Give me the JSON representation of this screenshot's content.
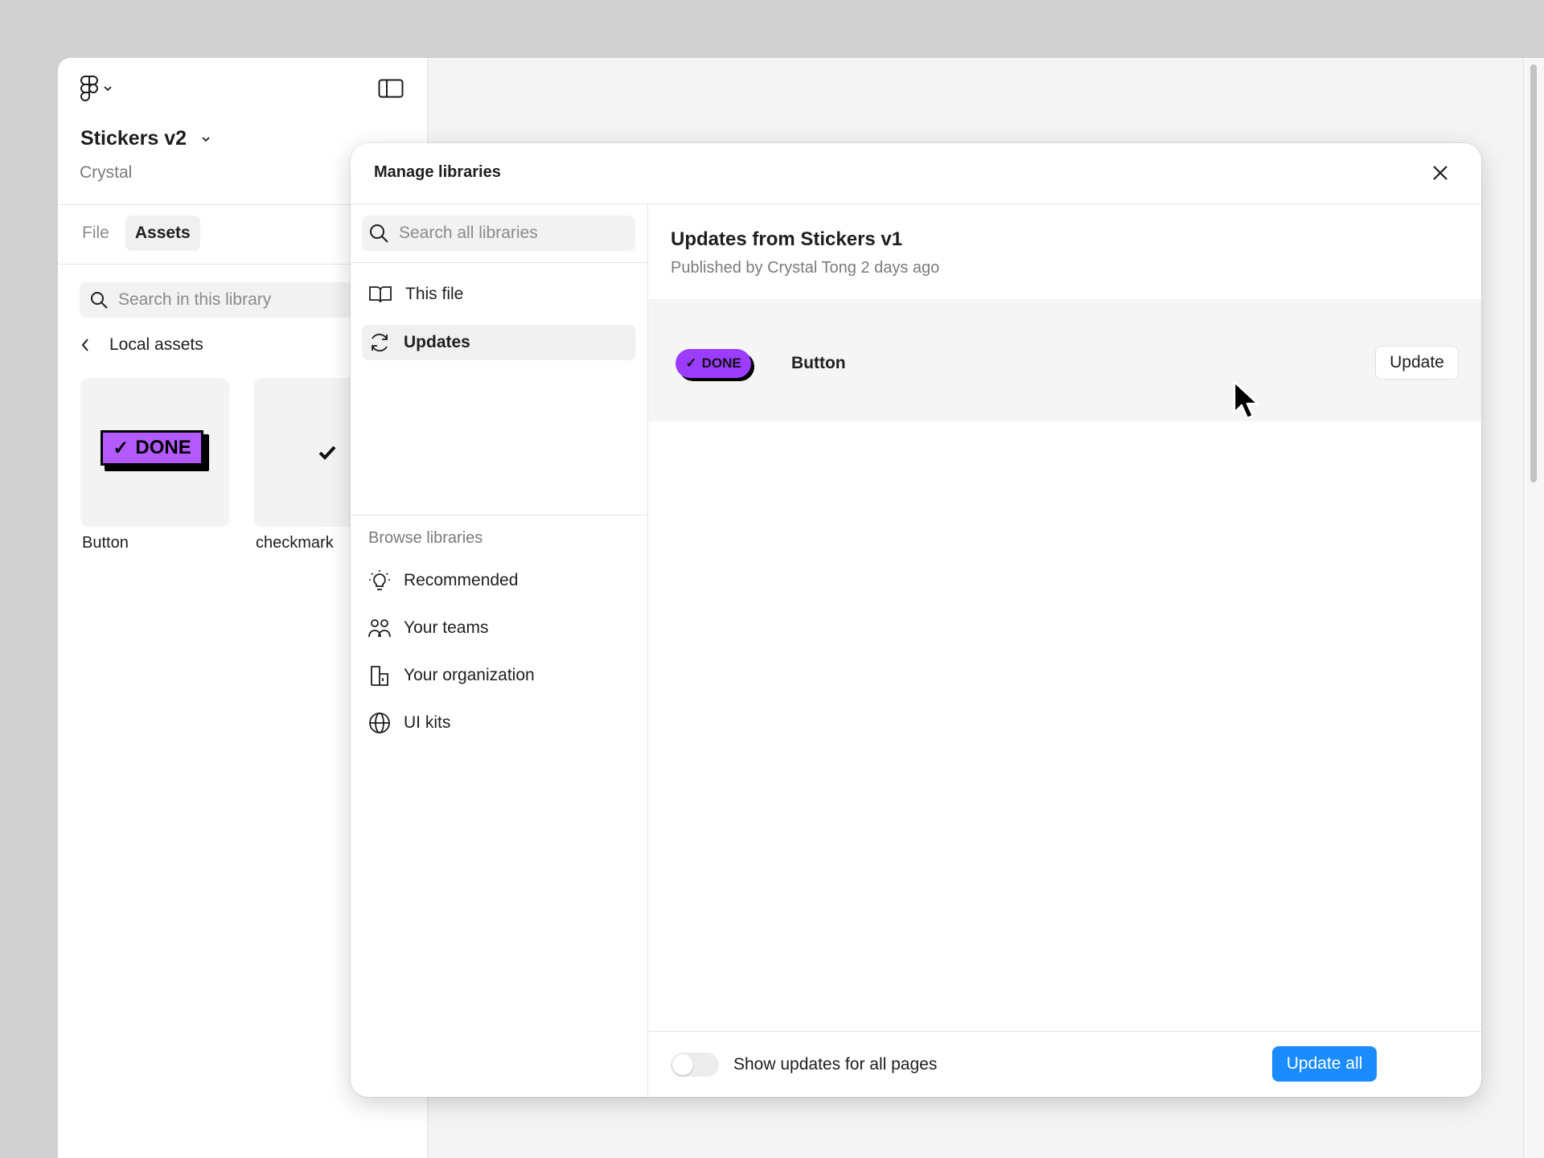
{
  "app": {
    "file_title": "Stickers v2",
    "owner": "Crystal"
  },
  "left_panel": {
    "tabs": [
      {
        "label": "File",
        "active": false
      },
      {
        "label": "Assets",
        "active": true
      }
    ],
    "search_placeholder": "Search in this library",
    "back_label": "Local assets",
    "assets": [
      {
        "label": "Button",
        "sticker_text": "DONE"
      },
      {
        "label": "checkmark"
      }
    ]
  },
  "modal": {
    "title": "Manage libraries",
    "search_placeholder": "Search all libraries",
    "nav": [
      {
        "label": "This file",
        "icon": "book-icon",
        "active": false
      },
      {
        "label": "Updates",
        "icon": "refresh-icon",
        "active": true
      }
    ],
    "browse_section": "Browse libraries",
    "browse": [
      {
        "label": "Recommended",
        "icon": "lightbulb-icon"
      },
      {
        "label": "Your teams",
        "icon": "people-icon"
      },
      {
        "label": "Your organization",
        "icon": "building-icon"
      },
      {
        "label": "UI kits",
        "icon": "globe-icon"
      }
    ],
    "content": {
      "title": "Updates from Stickers v1",
      "subtitle": "Published by Crystal Tong 2 days ago",
      "updates": [
        {
          "label": "Button",
          "pill_text": "DONE",
          "button": "Update"
        }
      ],
      "toggle_label": "Show updates for all pages",
      "toggle_on": false,
      "update_all": "Update all"
    }
  },
  "colors": {
    "accent": "#1a8cff",
    "sticker_purple": "#b35bff",
    "pill_purple": "#9b3cff"
  }
}
